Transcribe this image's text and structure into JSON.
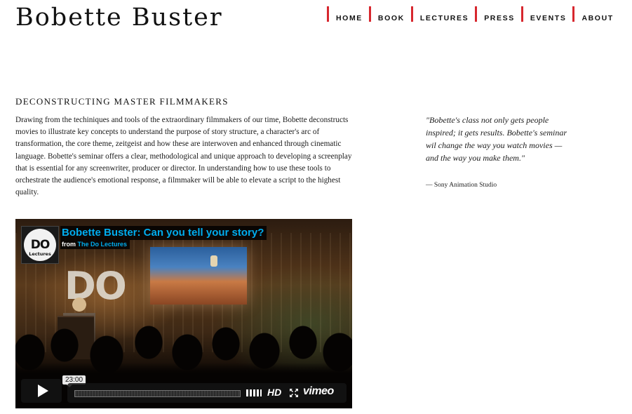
{
  "header": {
    "site_title": "Bobette Buster",
    "nav": [
      {
        "label": "HOME"
      },
      {
        "label": "BOOK"
      },
      {
        "label": "LECTURES"
      },
      {
        "label": "PRESS"
      },
      {
        "label": "EVENTS"
      },
      {
        "label": "ABOUT"
      }
    ],
    "nav_accent_color": "#d7272e"
  },
  "section": {
    "heading": "DECONSTRUCTING MASTER FILMMAKERS",
    "body": "Drawing from the techiniques and tools of the extraordinary filmmakers of our time, Bobette deconstructs movies to illustrate key concepts to understand the purpose of story structure, a character's arc of transformation, the core theme, zeitgeist and how these are interwoven and enhanced through cinematic language. Bobette's seminar offers a clear, methodological and unique approach to developing a screenplay that is essential for any screenwriter, producer or director. In understanding how to use these tools to orchestrate the audience's emotional response, a filmmaker will be able to elevate a script to the highest quality."
  },
  "quote": {
    "text": "\"Bobette's class not only gets people inspired; it gets results. Bobette's seminar wil change the way you watch movies — and the way you make them.\"",
    "source": "— Sony Animation Studio"
  },
  "video": {
    "title": "Bobette Buster: Can you tell your story?",
    "byline_prefix": "from",
    "byline_channel": "The Do Lectures",
    "avatar_text": "DO",
    "avatar_subtext": "Lectures",
    "stage_logo_text": "DO",
    "duration": "23:00",
    "hd_label": "HD",
    "brand": "vimeo",
    "title_color": "#00adef",
    "icons": [
      "play-icon",
      "volume-icon",
      "fullscreen-icon",
      "vimeo-logo"
    ]
  }
}
